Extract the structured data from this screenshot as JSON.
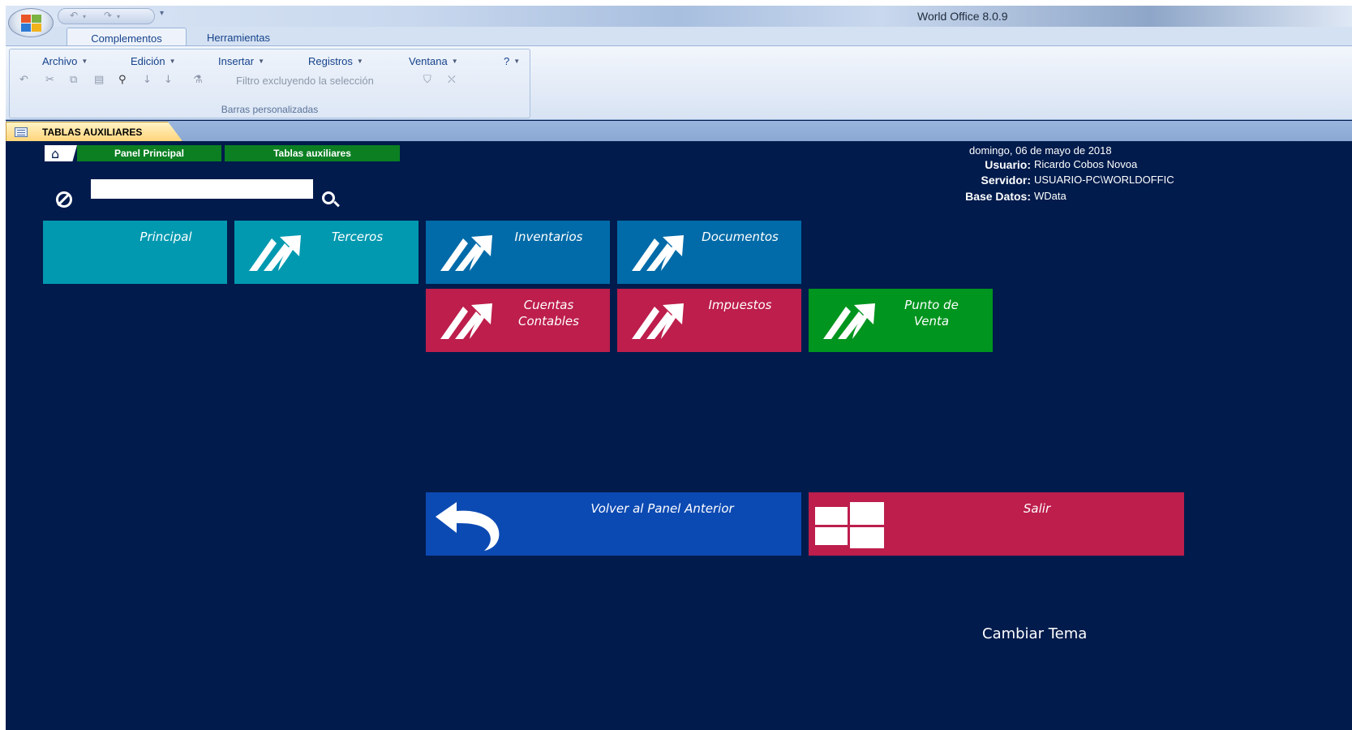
{
  "window": {
    "title": "World Office 8.0.9"
  },
  "ribbon": {
    "tabs": [
      {
        "label": "Complementos",
        "active": true
      },
      {
        "label": "Herramientas",
        "active": false
      }
    ],
    "menus": [
      "Archivo",
      "Edición",
      "Insertar",
      "Registros",
      "Ventana",
      "?"
    ],
    "filter_label": "Filtro excluyendo la selección",
    "group_label": "Barras personalizadas",
    "toolbar_icons": [
      "undo-icon",
      "cut-icon",
      "copy-icon",
      "paste-icon",
      "find-icon",
      "sort-ascending-icon",
      "sort-descending-icon",
      "filter-by-selection-icon",
      "filter-icon",
      "remove-filter-icon"
    ]
  },
  "document_tab": {
    "label": "TABLAS AUXILIARES"
  },
  "breadcrumb": {
    "items": [
      "Panel Principal",
      "Tablas auxiliares"
    ]
  },
  "search": {
    "value": "",
    "placeholder": ""
  },
  "info": {
    "date": "domingo, 06 de mayo de 2018",
    "user_label": "Usuario:",
    "user_value": "Ricardo Cobos Novoa",
    "server_label": "Servidor:",
    "server_value": "USUARIO-PC\\WORLDOFFIC",
    "db_label": "Base Datos:",
    "db_value": "WData"
  },
  "tiles": [
    {
      "id": "principal",
      "label": "Principal",
      "color": "#0199b0"
    },
    {
      "id": "terceros",
      "label": "Terceros",
      "color": "#0199b0"
    },
    {
      "id": "inventarios",
      "label": "Inventarios",
      "color": "#006ba8"
    },
    {
      "id": "documentos",
      "label": "Documentos",
      "color": "#006ba8"
    },
    {
      "id": "cuentas",
      "label_line1": "Cuentas",
      "label_line2": "Contables",
      "color": "#bd1e4c"
    },
    {
      "id": "impuestos",
      "label": "Impuestos",
      "color": "#bd1e4c"
    },
    {
      "id": "punto",
      "label_line1": "Punto de",
      "label_line2": "Venta",
      "color": "#00951e"
    },
    {
      "id": "volver",
      "label": "Volver al Panel Anterior",
      "color": "#0c4ab3"
    },
    {
      "id": "salir",
      "label": "Salir",
      "color": "#bd1e4c"
    }
  ],
  "footer": {
    "change_theme": "Cambiar Tema"
  },
  "colors": {
    "background": "#011b4c",
    "breadcrumb": "#0b7f22"
  }
}
